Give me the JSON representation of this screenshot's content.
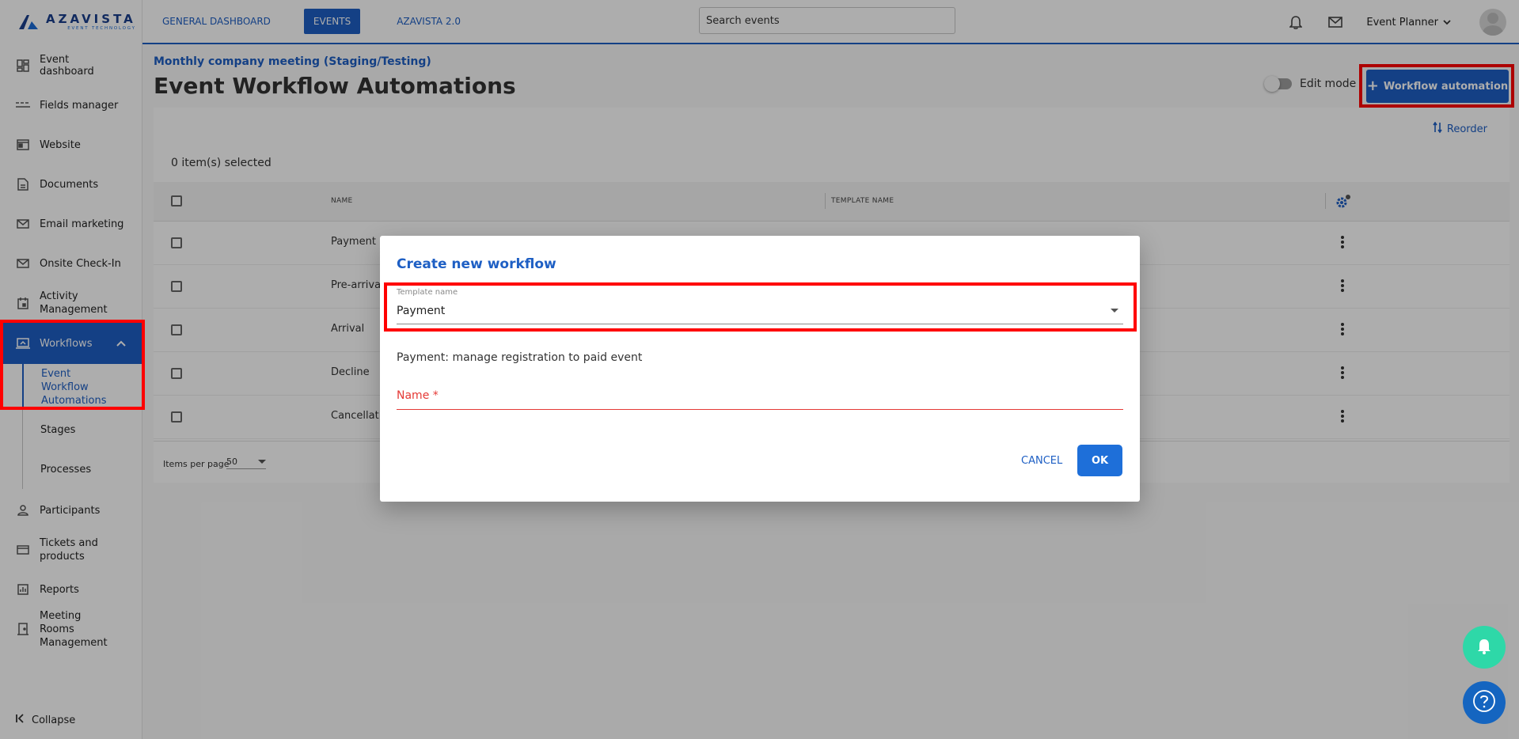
{
  "logo": {
    "name": "AZAVISTA",
    "tagline": "EVENT TECHNOLOGY"
  },
  "topbar": {
    "tabs": [
      {
        "label": "GENERAL DASHBOARD",
        "active": false
      },
      {
        "label": "EVENTS",
        "active": true
      },
      {
        "label": "AZAVISTA 2.0",
        "active": false
      }
    ],
    "search": {
      "value": "Search events"
    },
    "role": "Event Planner"
  },
  "sidebar": {
    "items": [
      {
        "label": "Event dashboard",
        "icon": "dashboard-icon"
      },
      {
        "label": "Fields manager",
        "icon": "fields-icon"
      },
      {
        "label": "Website",
        "icon": "website-icon"
      },
      {
        "label": "Documents",
        "icon": "document-icon"
      },
      {
        "label": "Email marketing",
        "icon": "mail-icon"
      },
      {
        "label": "Onsite Check-In",
        "icon": "mail-icon"
      },
      {
        "label": "Activity Management",
        "icon": "calendar-icon"
      },
      {
        "label": "Workflows",
        "icon": "workflow-icon"
      }
    ],
    "subitems": [
      {
        "label": "Event Workflow Automations"
      },
      {
        "label": "Stages"
      },
      {
        "label": "Processes"
      }
    ],
    "items_after": [
      {
        "label": "Participants",
        "icon": "person-icon"
      },
      {
        "label": "Tickets and products",
        "icon": "ticket-icon"
      },
      {
        "label": "Reports",
        "icon": "reports-icon"
      },
      {
        "label": "Meeting Rooms Management",
        "icon": "door-icon"
      }
    ],
    "collapse": "Collapse"
  },
  "main": {
    "breadcrumb": "Monthly company meeting (Staging/Testing)",
    "title": "Event Workflow Automations",
    "edit_mode": "Edit mode",
    "add_button": "Workflow automation",
    "reorder": "Reorder",
    "selected": "0 item(s) selected",
    "columns": {
      "name": "NAME",
      "template": "TEMPLATE NAME"
    },
    "rows": [
      {
        "name": "Payment re"
      },
      {
        "name": "Pre-arrival"
      },
      {
        "name": "Arrival"
      },
      {
        "name": "Decline"
      },
      {
        "name": "Cancellatio"
      }
    ],
    "items_per_page_label": "Items per page",
    "items_per_page_value": "50"
  },
  "modal": {
    "title": "Create new workflow",
    "template_label": "Template name",
    "template_value": "Payment",
    "description": "Payment: manage registration to paid event",
    "name_label": "Name *",
    "cancel": "CANCEL",
    "ok": "OK"
  },
  "colors": {
    "accent": "#1e5fc4",
    "highlight": "#ff0000",
    "error": "#e53935",
    "fab": "#2ed8a8"
  }
}
